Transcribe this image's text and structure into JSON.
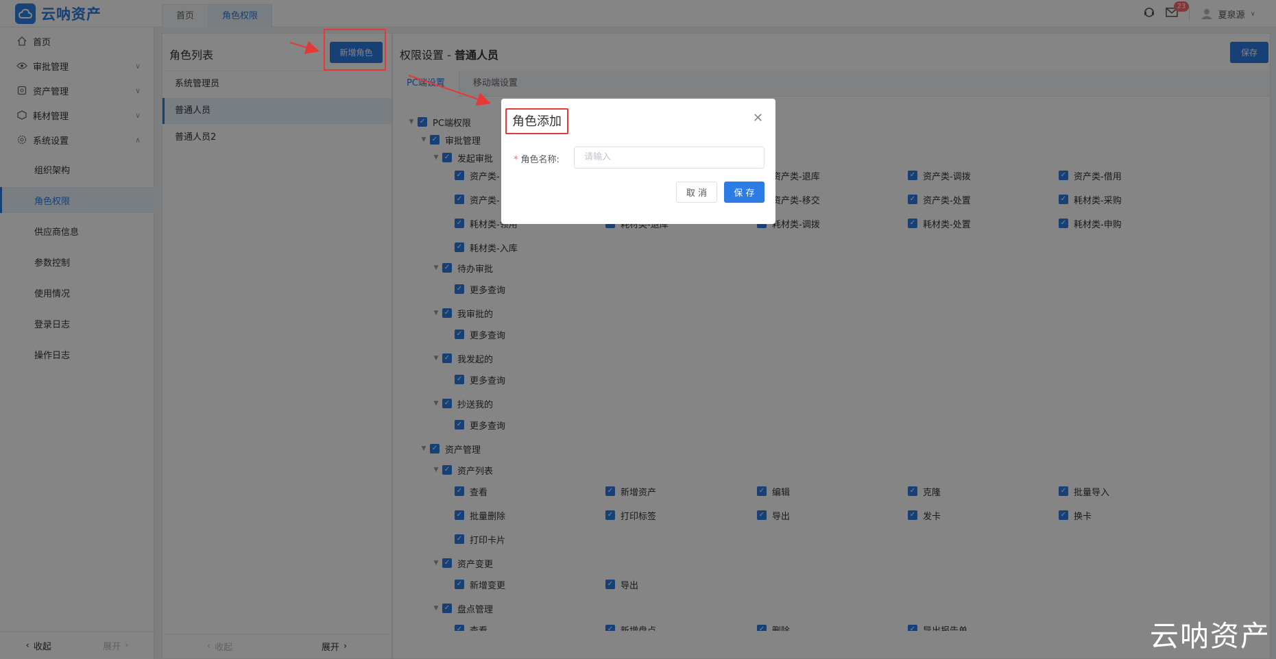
{
  "app": {
    "brand": "云呐资产"
  },
  "tabs": [
    "首页",
    "角色权限"
  ],
  "header": {
    "notification_count": "23",
    "user_name": "夏泉源"
  },
  "sidebar": {
    "menu": [
      {
        "label": "首页",
        "icon": "home-icon"
      },
      {
        "label": "审批管理",
        "icon": "eye-icon"
      },
      {
        "label": "资产管理",
        "icon": "settings-icon"
      },
      {
        "label": "耗材管理",
        "icon": "box-icon"
      },
      {
        "label": "系统设置",
        "icon": "gear-icon"
      }
    ],
    "submenu": [
      "组织架构",
      "角色权限",
      "供应商信息",
      "参数控制",
      "使用情况",
      "登录日志",
      "操作日志"
    ],
    "collapse": "收起",
    "expand": "展开"
  },
  "roles": {
    "title": "角色列表",
    "add_button": "新增角色",
    "items": [
      "系统管理员",
      "普通人员",
      "普通人员2"
    ],
    "footer_collapse": "收起",
    "footer_expand": "展开"
  },
  "perms": {
    "title_prefix": "权限设置 - ",
    "title_role": "普通人员",
    "save": "保存",
    "tabs": [
      "PC端设置",
      "移动端设置"
    ],
    "root": "PC端权限",
    "approval": "审批管理",
    "launch": "发起审批",
    "launch_row1": [
      "资产类-",
      "",
      "资产类-退库",
      "资产类-调拨",
      "资产类-借用"
    ],
    "launch_row2": [
      "资产类-",
      "",
      "资产类-移交",
      "资产类-处置",
      "耗材类-采购"
    ],
    "launch_row3": [
      "耗材类-领用",
      "耗材类-退库",
      "耗材类-调拨",
      "耗材类-处置",
      "耗材类-申购"
    ],
    "launch_row4": [
      "耗材类-入库"
    ],
    "pending": "待办审批",
    "approved": "我审批的",
    "initiated": "我发起的",
    "cc": "抄送我的",
    "more_query": "更多查询",
    "asset_mgmt": "资产管理",
    "asset_list": "资产列表",
    "asset_row1": [
      "查看",
      "新增资产",
      "编辑",
      "克隆",
      "批量导入"
    ],
    "asset_row2": [
      "批量删除",
      "打印标签",
      "导出",
      "发卡",
      "换卡"
    ],
    "asset_row3": [
      "打印卡片"
    ],
    "asset_change": "资产变更",
    "change_row": [
      "新增变更",
      "导出"
    ],
    "inventory": "盘点管理",
    "inventory_row": [
      "查看",
      "新增盘点",
      "删除",
      "导出报告单"
    ]
  },
  "modal": {
    "title": "角色添加",
    "label": "角色名称:",
    "placeholder": "请输入",
    "cancel": "取 消",
    "save": "保 存"
  },
  "watermark": "云呐资产"
}
